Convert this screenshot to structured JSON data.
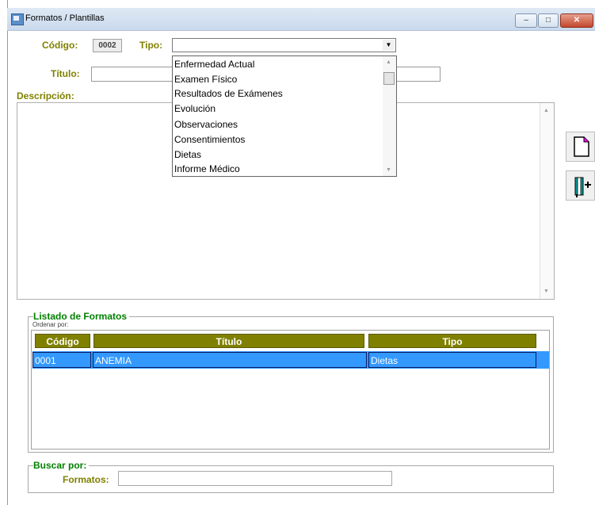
{
  "window": {
    "title": "Formatos / Plantillas",
    "min_label": "–",
    "max_label": "□",
    "close_label": "✕"
  },
  "form": {
    "codigo_label": "Código:",
    "codigo_value": "0002",
    "tipo_label": "Tipo:",
    "tipo_value": "",
    "titulo_label": "Título:",
    "titulo_value": "",
    "descripcion_label": "Descripción:",
    "descripcion_value": ""
  },
  "tipo_dropdown": {
    "options": [
      "Enfermedad Actual",
      "Examen Físico",
      "Resultados de Exámenes",
      "Evolución",
      "Observaciones",
      "Consentimientos",
      "Dietas",
      "Informe Médico"
    ]
  },
  "side_buttons": {
    "new_icon": "new-document-icon",
    "insert_icon": "insert-column-icon"
  },
  "list": {
    "legend": "Listado de Formatos",
    "order_label": "Ordenar por:",
    "columns": [
      "Código",
      "Título",
      "Tipo"
    ],
    "rows": [
      {
        "codigo": "0001",
        "titulo": "ANEMIA",
        "tipo": "Dietas"
      }
    ]
  },
  "search": {
    "legend": "Buscar por:",
    "formatos_label": "Formatos:",
    "formatos_value": ""
  },
  "colors": {
    "label_olive": "#808000",
    "legend_green": "#008000",
    "selection_blue": "#3399ff"
  }
}
